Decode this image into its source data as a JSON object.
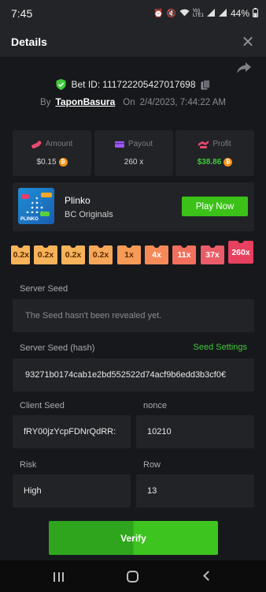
{
  "status_bar": {
    "time": "7:45",
    "icons": [
      "alarm-icon",
      "mute-icon",
      "wifi-icon",
      "volte-icon",
      "signal-icon",
      "signal-icon",
      "battery-icon"
    ],
    "volte": "Vo) LTE1",
    "battery": "44%"
  },
  "header": {
    "title": "Details",
    "close_icon": "close-icon"
  },
  "bet": {
    "id_label": "Bet ID:",
    "id_value": "111722205427017698",
    "by_label": "By",
    "user": "TaponBasura",
    "on_label": "On",
    "datetime": "2/4/2023, 7:44:22 AM"
  },
  "stats": {
    "amount": {
      "label": "Amount",
      "value": "$0.15",
      "icon": "coins-icon"
    },
    "payout": {
      "label": "Payout",
      "value": "260 x",
      "icon": "wallet-icon"
    },
    "profit": {
      "label": "Profit",
      "value": "$38.86",
      "icon": "profit-icon"
    }
  },
  "game": {
    "name": "Plinko",
    "subtitle": "BC Originals",
    "play_label": "Play Now",
    "thumb_label": "PLINKO"
  },
  "multipliers": [
    "0.2x",
    "0.2x",
    "0.2x",
    "0.2x",
    "1x",
    "4x",
    "11x",
    "37x",
    "260x"
  ],
  "multiplier_colors": [
    "#f7b35a",
    "#f7b35a",
    "#f7b35a",
    "#f7a75a",
    "#f79a55",
    "#f58a58",
    "#f0705d",
    "#ea5c68",
    "#e8405f"
  ],
  "fields": {
    "server_seed_label": "Server Seed",
    "server_seed_value": "The Seed hasn't been revealed yet.",
    "server_seed_hash_label": "Server Seed (hash)",
    "seed_settings_label": "Seed Settings",
    "server_seed_hash_value": "93271b0174cab1e2bd552522d74acf9b6edd3b3cf0€",
    "client_seed_label": "Client Seed",
    "client_seed_value": "fRY00jzYcpFDNrQdRR:",
    "nonce_label": "nonce",
    "nonce_value": "10210",
    "risk_label": "Risk",
    "risk_value": "High",
    "row_label": "Row",
    "row_value": "13"
  },
  "verify_label": "Verify",
  "colors": {
    "background": "#17181b",
    "card": "#222327",
    "accent_green": "#3bc117"
  }
}
